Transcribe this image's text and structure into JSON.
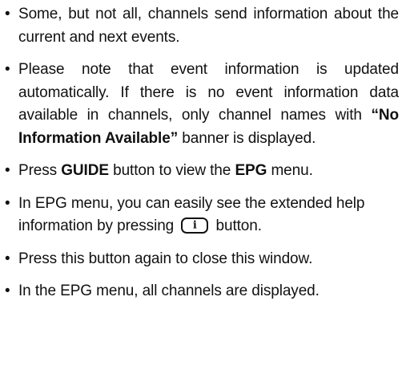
{
  "bullet_char": "•",
  "items": [
    {
      "text": "Some, but not all, channels send information about the current and next events."
    },
    {
      "text_a": "Please note that event information is updated automatically. If there is no event information data available in channels, only channel names with ",
      "bold_a": "“No Information Available”",
      "text_b": " banner is displayed."
    },
    {
      "text_a": "Press ",
      "bold_a": "GUIDE",
      "text_b": " button to view the ",
      "bold_b": "EPG",
      "text_c": " menu."
    },
    {
      "text_a": "In EPG menu, you can easily see the extended help information by pressing",
      "icon": "info-button-icon",
      "icon_letter": "i",
      "text_b": "button."
    },
    {
      "text": "Press this button again to close this window."
    },
    {
      "text": "In the EPG menu, all channels are displayed."
    }
  ]
}
